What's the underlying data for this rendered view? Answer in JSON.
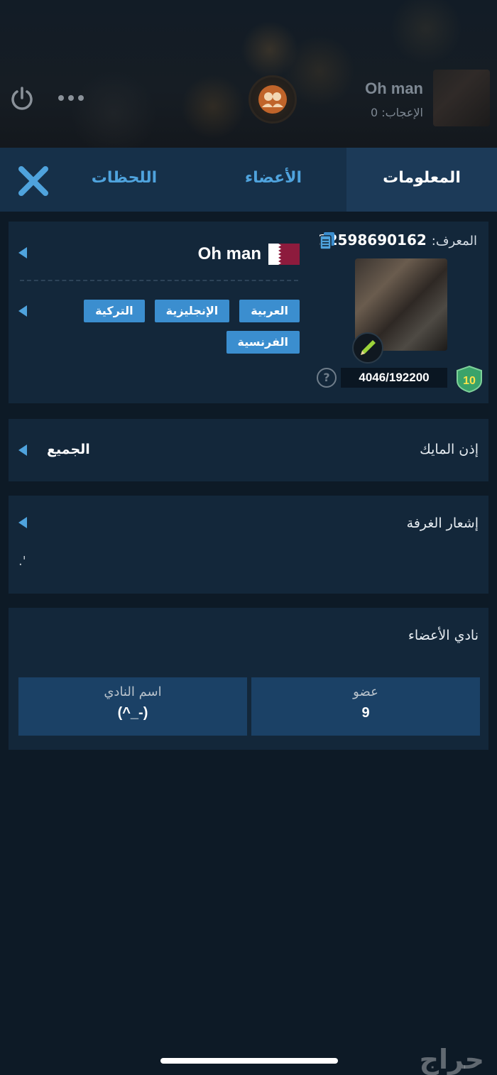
{
  "header": {
    "room_title": "Oh man",
    "likes_label": "الإعجاب: 0"
  },
  "tabs": [
    {
      "label": "المعلومات",
      "active": true
    },
    {
      "label": "الأعضاء",
      "active": false
    },
    {
      "label": "اللحظات",
      "active": false
    }
  ],
  "info": {
    "id_label": "المعرف:",
    "id_value": "12598690162",
    "room_name": "Oh man",
    "xp": "4046/192200",
    "level": "10",
    "help": "?",
    "languages": [
      "العربية",
      "الإنجليزية",
      "التركية",
      "الفرنسية"
    ]
  },
  "mic_permission": {
    "label": "إذن المايك",
    "value": "الجميع"
  },
  "room_notice": {
    "label": "إشعار الغرفة",
    "text": ".'"
  },
  "members_club": {
    "title": "نادي الأعضاء",
    "member_label": "عضو",
    "member_value": "9",
    "club_name_label": "اسم النادي",
    "club_name_value": "(^_-)"
  },
  "watermark": "حراج",
  "colors": {
    "accent": "#4fa3dd",
    "tag": "#3b8ecf",
    "panel": "#13273a",
    "tab_bar": "#163049"
  }
}
